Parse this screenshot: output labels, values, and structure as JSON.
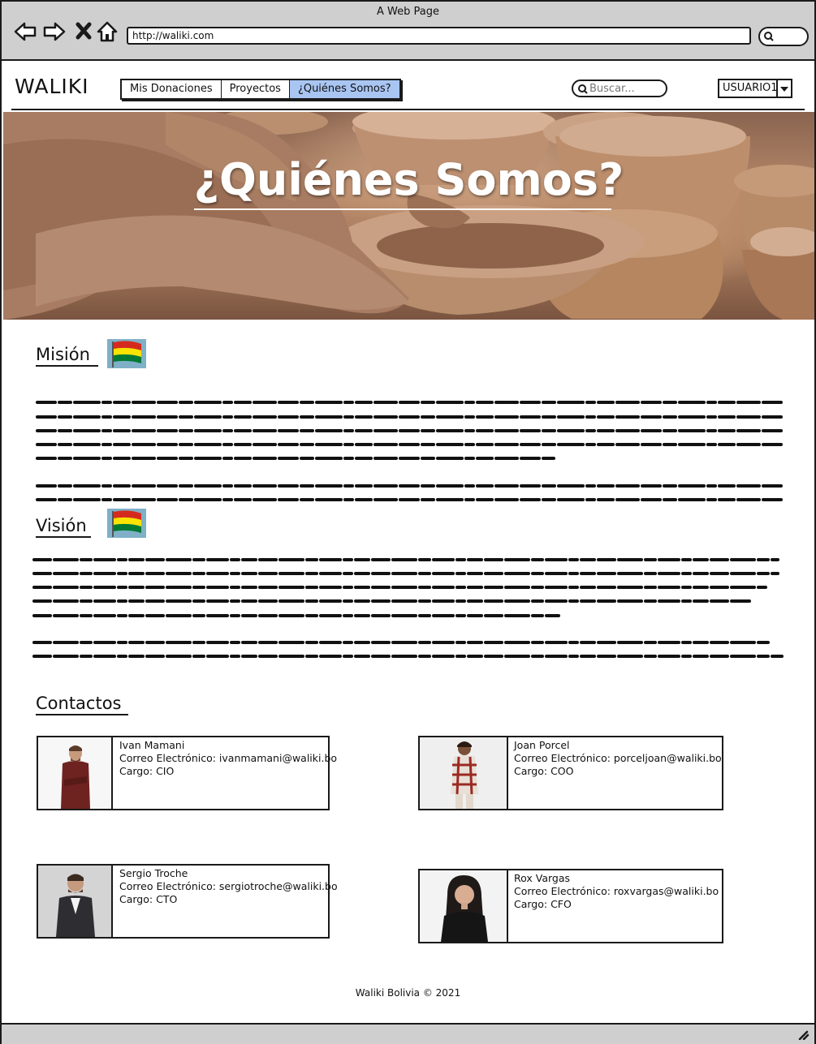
{
  "browser": {
    "title": "A Web Page",
    "url": "http://waliki.com"
  },
  "header": {
    "logo": "WALIKI",
    "tabs": [
      {
        "label": "Mis Donaciones",
        "active": false
      },
      {
        "label": "Proyectos",
        "active": false
      },
      {
        "label": "¿Quiénes Somos?",
        "active": true
      }
    ],
    "search_placeholder": "Buscar...",
    "user": "USUARIO1",
    "active_tab_color": "#a9c5f2"
  },
  "hero": {
    "title": "¿Quiénes Somos?"
  },
  "mission": {
    "title": "Misión"
  },
  "vision": {
    "title": "Visión"
  },
  "contacts": {
    "title": "Contactos",
    "people": [
      {
        "name": "Ivan Mamani",
        "email": "Correo Electrónico: ivanmamani@waliki.bo",
        "role": "Cargo: CIO"
      },
      {
        "name": "Joan Porcel",
        "email": "Correo Electrónico: porceljoan@waliki.bo",
        "role": "Cargo: COO"
      },
      {
        "name": "Sergio Troche",
        "email": "Correo Electrónico: sergiotroche@waliki.bo",
        "role": "Cargo: CTO"
      },
      {
        "name": "Rox Vargas",
        "email": "Correo Electrónico: roxvargas@waliki.bo",
        "role": "Cargo: CFO"
      }
    ]
  },
  "footer": {
    "text": "Waliki Bolivia © 2021"
  }
}
